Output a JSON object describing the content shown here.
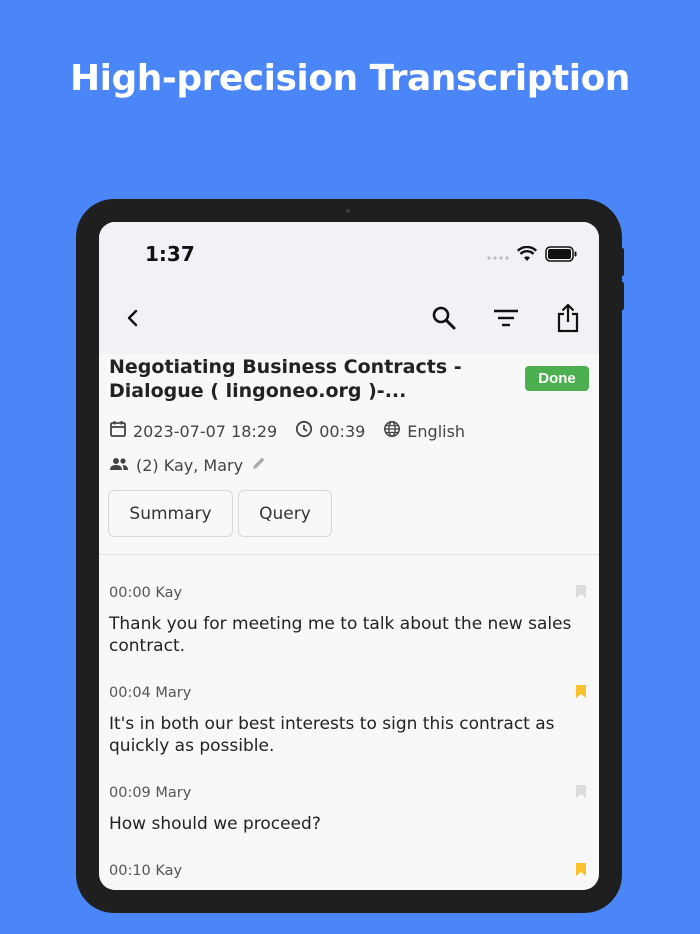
{
  "headline": "High-precision Transcription",
  "status_bar": {
    "time": "1:37"
  },
  "recording": {
    "title": "Negotiating Business Contracts - Dialogue ( lingoneo.org )-...",
    "status": "Done",
    "date": "2023-07-07 18:29",
    "duration": "00:39",
    "language": "English",
    "speakers": "(2) Kay, Mary"
  },
  "actions": {
    "summary": "Summary",
    "query": "Query"
  },
  "transcript": [
    {
      "time": "00:00",
      "speaker": "Kay",
      "text": "Thank you for meeting me to talk about the new sales contract.",
      "bookmarked": false
    },
    {
      "time": "00:04",
      "speaker": "Mary",
      "text": "It's in both our best interests to sign this contract as quickly as possible.",
      "bookmarked": true
    },
    {
      "time": "00:09",
      "speaker": "Mary",
      "text": "How should we proceed?",
      "bookmarked": false
    },
    {
      "time": "00:10",
      "speaker": "Kay",
      "text": "",
      "bookmarked": true
    }
  ],
  "icons": {
    "back": "chevron-left-icon",
    "search": "search-icon",
    "filter": "filter-icon",
    "share": "share-icon",
    "calendar": "calendar-icon",
    "clock": "clock-icon",
    "globe": "globe-icon",
    "people": "people-icon",
    "edit": "pencil-icon",
    "bookmark": "bookmark-icon"
  },
  "colors": {
    "background": "#4a86f7",
    "done_badge": "#4caf50",
    "bookmark_active": "#fbc02d",
    "bookmark_inactive": "#dcdcdc"
  }
}
